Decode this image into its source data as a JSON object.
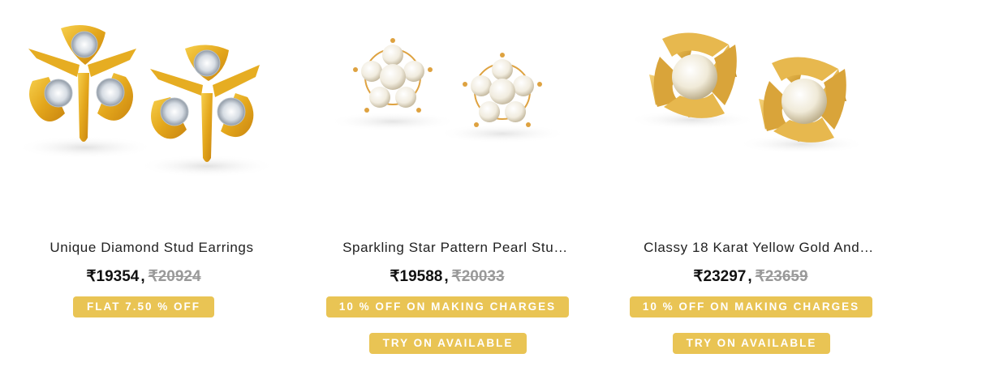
{
  "colors": {
    "badge_bg": "#e9c454",
    "badge_text": "#ffffff",
    "old_price": "#999999",
    "gold": "#e0a623"
  },
  "products": [
    {
      "image": "diamond-trefoil-stud-earrings",
      "title": "Unique Diamond Stud Earrings",
      "price": "₹19354",
      "separator": ",",
      "old_price": "₹20924",
      "offer": "FLAT 7.50 % OFF",
      "try_on": ""
    },
    {
      "image": "pearl-star-stud-earrings",
      "title": "Sparkling Star Pattern Pearl Stu…",
      "price": "₹19588",
      "separator": ",",
      "old_price": "₹20033",
      "offer": "10 % OFF ON MAKING CHARGES",
      "try_on": "TRY ON AVAILABLE"
    },
    {
      "image": "gold-pinwheel-pearl-stud-earrings",
      "title": "Classy 18 Karat Yellow Gold And…",
      "price": "₹23297",
      "separator": ",",
      "old_price": "₹23659",
      "offer": "10 % OFF ON MAKING CHARGES",
      "try_on": "TRY ON AVAILABLE"
    }
  ]
}
